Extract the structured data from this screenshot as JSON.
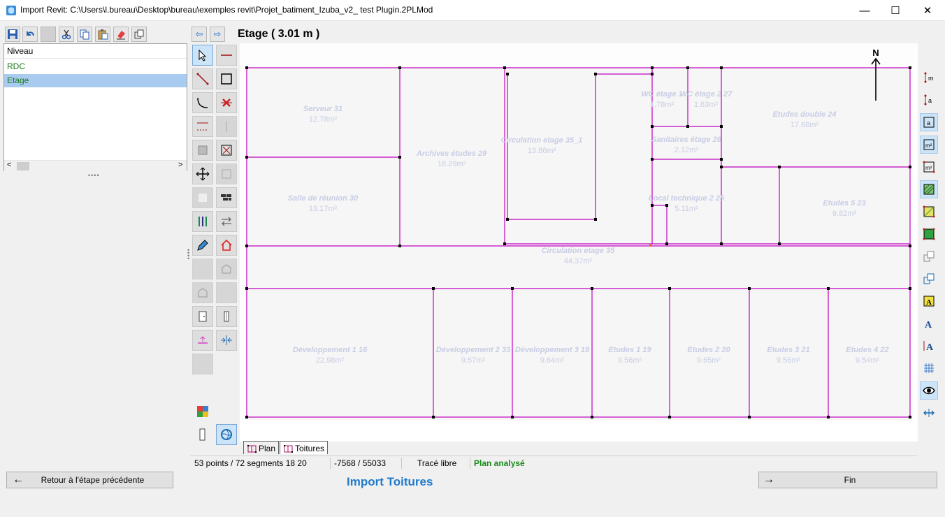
{
  "window": {
    "title": "Import Revit: C:\\Users\\l.bureau\\Desktop\\bureau\\exemples revit\\Projet_batiment_Izuba_v2_ test Plugin.2PLMod",
    "minimize": "—",
    "maximize": "☐",
    "close": "✕"
  },
  "toolbar": {
    "icons": [
      "save-icon",
      "undo-icon",
      "blank",
      "cut-icon",
      "copy-icon",
      "paste-icon",
      "eraser-icon",
      "duplicate-icon"
    ]
  },
  "niveau": {
    "header": "Niveau",
    "items": [
      {
        "label": "RDC",
        "selected": false
      },
      {
        "label": "Etage",
        "selected": true
      }
    ],
    "scroll_left": "<",
    "scroll_right": ">"
  },
  "nav": {
    "back": "⇦",
    "forward": "⇨"
  },
  "level_title": "Etage ( 3.01 m )",
  "compass": "N",
  "rooms": [
    {
      "name": "Serveur 31",
      "area": "12.78m²"
    },
    {
      "name": "Archives études 29",
      "area": "18.29m²"
    },
    {
      "name": "Circulation etage 35_1",
      "area": "13.86m²"
    },
    {
      "name": "WC étage 1",
      "area": "1.78m²"
    },
    {
      "name": "WC étage 2 27",
      "area": "1.63m²"
    },
    {
      "name": "Etudes double 24",
      "area": "17.68m²"
    },
    {
      "name": "Sanitaires étage 26",
      "area": "2.12m²"
    },
    {
      "name": "Salle de réunion 30",
      "area": "13.17m²"
    },
    {
      "name": "Local technique 2 25",
      "area": "5.11m²"
    },
    {
      "name": "Etudes 5 23",
      "area": "9.82m²"
    },
    {
      "name": "Circulation etage 35",
      "area": "44.37m²"
    },
    {
      "name": "Développement 1 16",
      "area": "22.98m²"
    },
    {
      "name": "Développement 2 33",
      "area": "9.57m²"
    },
    {
      "name": "Développement 3 18",
      "area": "9.64m²"
    },
    {
      "name": "Etudes 1 19",
      "area": "9.56m²"
    },
    {
      "name": "Etudes 2 20",
      "area": "9.65m²"
    },
    {
      "name": "Etudes 3 21",
      "area": "9.56m²"
    },
    {
      "name": "Etudes 4 22",
      "area": "9.54m²"
    }
  ],
  "tabs": [
    {
      "label": "Plan",
      "active": false
    },
    {
      "label": "Toitures",
      "active": true
    }
  ],
  "status": {
    "counts": "53 points / 72 segments 18 20",
    "coords": "-7568 / 55033",
    "mode": "Tracé libre",
    "state": "Plan analysé"
  },
  "buttons": {
    "back": "Retour à l'étape précédente",
    "back_arrow": "←",
    "fin": "Fin",
    "fin_arrow": "→"
  },
  "step_title": "Import Toitures",
  "colors": {
    "wall": "#c000c0",
    "selection": "#cce4f7",
    "status_ok": "#1a8a1a",
    "step_title": "#1f7acc",
    "room_text": "#c8cde4"
  }
}
